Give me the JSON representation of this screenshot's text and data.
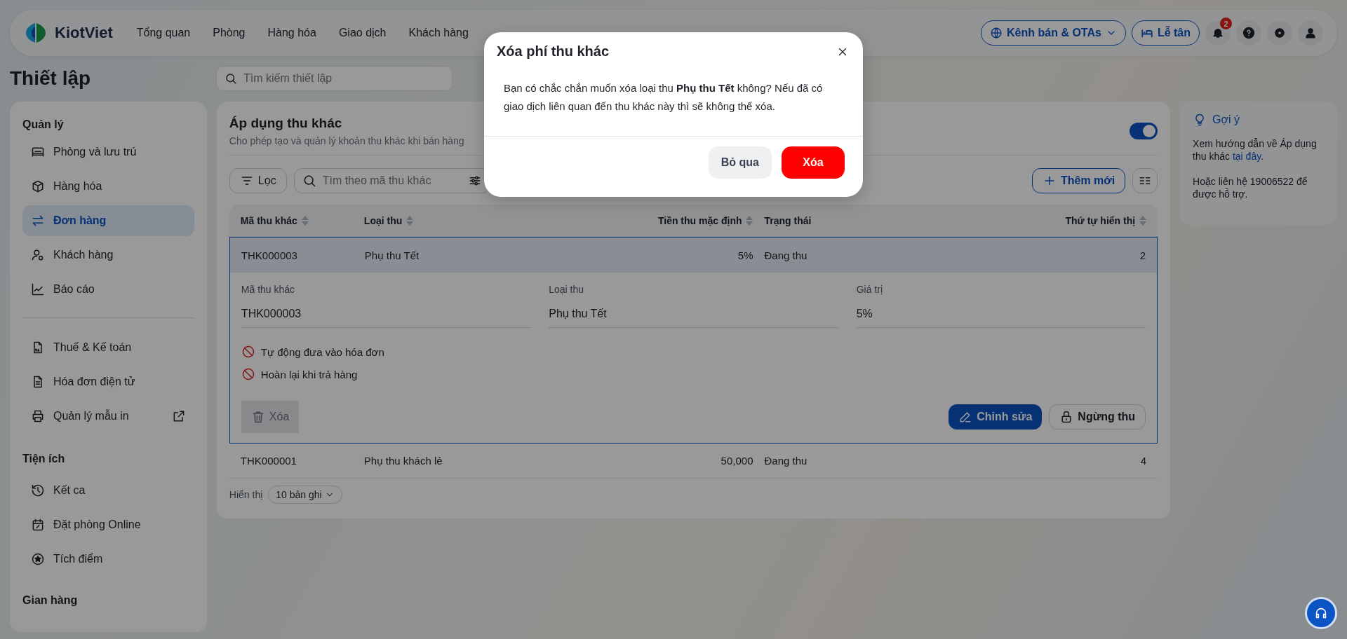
{
  "nav": {
    "brand": "KiotViet",
    "items": [
      "Tổng quan",
      "Phòng",
      "Hàng hóa",
      "Giao dịch",
      "Khách hàng"
    ],
    "channel_button": "Kênh bán & OTAs",
    "reception_button": "Lễ tân",
    "notification_count": "2"
  },
  "page_title": "Thiết lập",
  "settings_search": {
    "placeholder": "Tìm kiếm thiết lập"
  },
  "sidebar": {
    "sections": [
      {
        "title": "Quản lý",
        "items": [
          {
            "label": "Phòng và lưu trú",
            "selected": false,
            "external": false
          },
          {
            "label": "Hàng hóa",
            "selected": false,
            "external": false
          },
          {
            "label": "Đơn hàng",
            "selected": true,
            "external": false
          },
          {
            "label": "Khách hàng",
            "selected": false,
            "external": false
          },
          {
            "label": "Báo cáo",
            "selected": false,
            "external": false
          }
        ]
      },
      {
        "items": [
          {
            "label": "Thuế & Kế toán",
            "selected": false,
            "external": false
          },
          {
            "label": "Hóa đơn điện tử",
            "selected": false,
            "external": false
          },
          {
            "label": "Quản lý mẫu in",
            "selected": false,
            "external": true
          }
        ]
      },
      {
        "title": "Tiện ích",
        "items": [
          {
            "label": "Kết ca",
            "selected": false,
            "external": false
          },
          {
            "label": "Đặt phòng Online",
            "selected": false,
            "external": false
          },
          {
            "label": "Tích điểm",
            "selected": false,
            "external": false
          }
        ]
      },
      {
        "title": "Gian hàng"
      }
    ]
  },
  "main": {
    "title": "Áp dụng thu khác",
    "description": "Cho phép tạo và quản lý khoản thu khác khi bán hàng",
    "enabled": true,
    "filter_button": "Lọc",
    "search": {
      "placeholder": "Tìm theo mã thu khác"
    },
    "add_button": "Thêm mới",
    "table": {
      "columns": [
        {
          "label": "Mã thu khác",
          "sortable": true
        },
        {
          "label": "Loại thu",
          "sortable": true
        },
        {
          "label": "Tiền thu mặc định",
          "sortable": true
        },
        {
          "label": "Trạng thái",
          "sortable": false
        },
        {
          "label": "Thứ tự hiển thị",
          "sortable": true
        }
      ],
      "rows": [
        {
          "cells": [
            "THK000003",
            "Phụ thu Tết",
            "5%",
            "Đang thu",
            "2"
          ],
          "expanded": true,
          "detail": {
            "fields": [
              {
                "label": "Mã thu khác",
                "value": "THK000003"
              },
              {
                "label": "Loại thu",
                "value": "Phụ thu Tết"
              },
              {
                "label": "Giá trị",
                "value": "5%"
              }
            ],
            "options": [
              {
                "label": "Tự động đưa vào hóa đơn",
                "enabled": false
              },
              {
                "label": "Hoàn lại khi trả hàng",
                "enabled": false
              }
            ],
            "delete_button": "Xóa",
            "edit_button": "Chỉnh sửa",
            "stop_button": "Ngừng thu"
          }
        },
        {
          "cells": [
            "THK000001",
            "Phụ thu khách lẻ",
            "50,000",
            "Đang thu",
            "4"
          ],
          "expanded": false
        }
      ]
    },
    "page_size": {
      "label": "Hiển thị",
      "value": "10 bản ghi"
    }
  },
  "hint": {
    "title": "Gợi ý",
    "guide_text": "Xem hướng dẫn về Áp dụng thu khác",
    "guide_link": "tại đây",
    "guide_end": ".",
    "contact": "Hoặc liên hệ 19006522 để được hỗ trợ."
  },
  "modal": {
    "title": "Xóa phí thu khác",
    "message": "Bạn có chắc chắn muốn xóa loại thu **Phụ thu Tết** không? Nếu đã có giao dịch liên quan đến thu khác này thì sẽ không thể xóa.",
    "cancel_button": "Bỏ qua",
    "confirm_button": "Xóa"
  }
}
